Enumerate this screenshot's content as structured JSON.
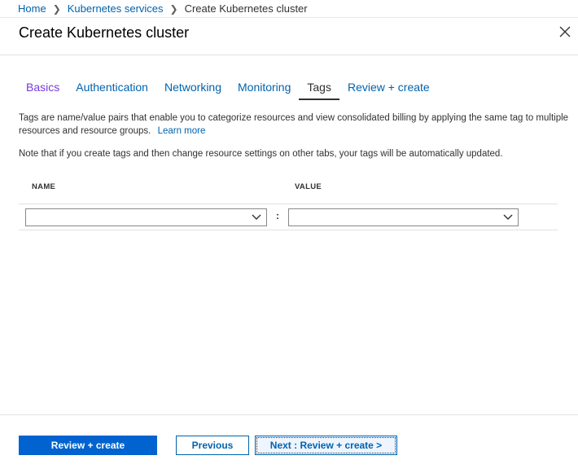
{
  "breadcrumb": {
    "items": [
      "Home",
      "Kubernetes services"
    ],
    "current": "Create Kubernetes cluster"
  },
  "header": {
    "title": "Create Kubernetes cluster"
  },
  "tabs": [
    {
      "label": "Basics",
      "state": "visited"
    },
    {
      "label": "Authentication",
      "state": "default"
    },
    {
      "label": "Networking",
      "state": "default"
    },
    {
      "label": "Monitoring",
      "state": "default"
    },
    {
      "label": "Tags",
      "state": "active"
    },
    {
      "label": "Review + create",
      "state": "default"
    }
  ],
  "content": {
    "description": "Tags are name/value pairs that enable you to categorize resources and view consolidated billing by applying the same tag to multiple resources and resource groups.",
    "learn_more": "Learn more",
    "note": "Note that if you create tags and then change resource settings on other tabs, your tags will be automatically updated."
  },
  "tag_table": {
    "name_header": "NAME",
    "value_header": "VALUE",
    "separator": ":",
    "name_value": "",
    "value_value": ""
  },
  "footer": {
    "review_create_label": "Review + create",
    "previous_label": "Previous",
    "next_label": "Next : Review + create >"
  },
  "colors": {
    "link": "#0062ad",
    "visited": "#773adc",
    "primary": "#0063cf"
  }
}
